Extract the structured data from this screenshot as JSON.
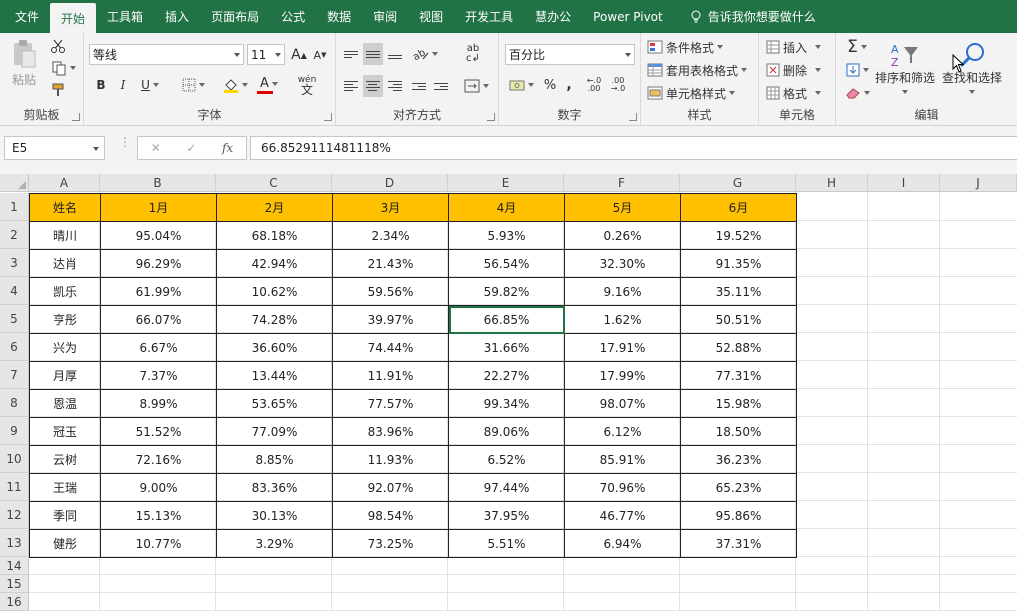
{
  "tabs": [
    "文件",
    "开始",
    "工具箱",
    "插入",
    "页面布局",
    "公式",
    "数据",
    "审阅",
    "视图",
    "开发工具",
    "慧办公",
    "Power Pivot"
  ],
  "active_tab": "开始",
  "tell_me": "告诉我你想要做什么",
  "ribbon": {
    "clipboard": {
      "label": "剪贴板",
      "paste": "粘贴"
    },
    "font": {
      "label": "字体",
      "font_name": "等线",
      "font_size": "11",
      "bold": "B",
      "italic": "I",
      "underline": "U",
      "grow": "A",
      "shrink": "A",
      "font_color": "A",
      "phonetic": "wén"
    },
    "alignment": {
      "label": "对齐方式"
    },
    "number": {
      "label": "数字",
      "format": "百分比",
      "percent": "%",
      "comma": ","
    },
    "styles": {
      "label": "样式",
      "conditional": "条件格式",
      "table": "套用表格格式",
      "cell": "单元格样式"
    },
    "cells": {
      "label": "单元格",
      "insert": "插入",
      "delete": "删除",
      "format": "格式"
    },
    "editing": {
      "label": "编辑",
      "sort": "排序和筛选",
      "find": "查找和选择"
    }
  },
  "formula_bar": {
    "name_box": "E5",
    "cancel": "✕",
    "enter": "✓",
    "fx": "fx",
    "value": "66.8529111481118%"
  },
  "columns": [
    "A",
    "B",
    "C",
    "D",
    "E",
    "F",
    "G",
    "H",
    "I",
    "J"
  ],
  "rows": [
    "1",
    "2",
    "3",
    "4",
    "5",
    "6",
    "7",
    "8",
    "9",
    "10",
    "11",
    "12",
    "13",
    "14",
    "15",
    "16"
  ],
  "table": {
    "headers": [
      "姓名",
      "1月",
      "2月",
      "3月",
      "4月",
      "5月",
      "6月"
    ],
    "rows": [
      [
        "晴川",
        "95.04%",
        "68.18%",
        "2.34%",
        "5.93%",
        "0.26%",
        "19.52%"
      ],
      [
        "达肖",
        "96.29%",
        "42.94%",
        "21.43%",
        "56.54%",
        "32.30%",
        "91.35%"
      ],
      [
        "凯乐",
        "61.99%",
        "10.62%",
        "59.56%",
        "59.82%",
        "9.16%",
        "35.11%"
      ],
      [
        "亨彤",
        "66.07%",
        "74.28%",
        "39.97%",
        "66.85%",
        "1.62%",
        "50.51%"
      ],
      [
        "兴为",
        "6.67%",
        "36.60%",
        "74.44%",
        "31.66%",
        "17.91%",
        "52.88%"
      ],
      [
        "月厚",
        "7.37%",
        "13.44%",
        "11.91%",
        "22.27%",
        "17.99%",
        "77.31%"
      ],
      [
        "恩温",
        "8.99%",
        "53.65%",
        "77.57%",
        "99.34%",
        "98.07%",
        "15.98%"
      ],
      [
        "冠玉",
        "51.52%",
        "77.09%",
        "83.96%",
        "89.06%",
        "6.12%",
        "18.50%"
      ],
      [
        "云树",
        "72.16%",
        "8.85%",
        "11.93%",
        "6.52%",
        "85.91%",
        "36.23%"
      ],
      [
        "王瑞",
        "9.00%",
        "83.36%",
        "92.07%",
        "97.44%",
        "70.96%",
        "65.23%"
      ],
      [
        "季同",
        "15.13%",
        "30.13%",
        "98.54%",
        "37.95%",
        "46.77%",
        "95.86%"
      ],
      [
        "健彤",
        "10.77%",
        "3.29%",
        "73.25%",
        "5.51%",
        "6.94%",
        "37.31%"
      ]
    ]
  },
  "colors": {
    "excel_green": "#217346",
    "header_fill": "#ffc000"
  }
}
